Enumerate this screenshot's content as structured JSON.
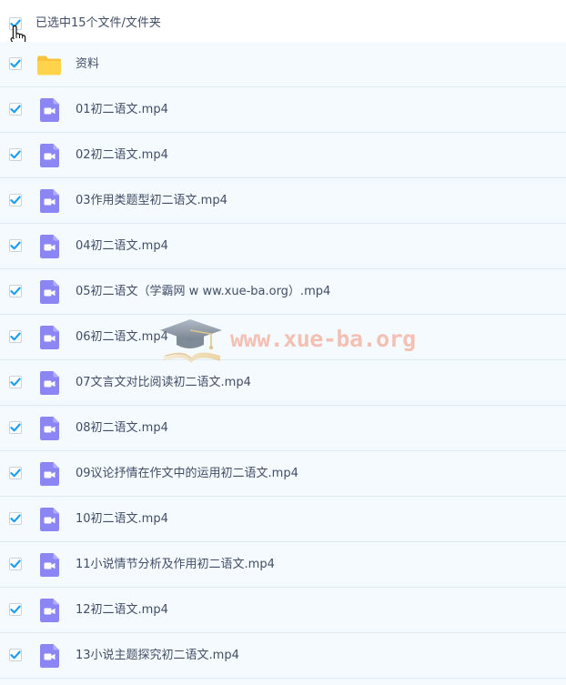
{
  "header": {
    "selection_label": "已选中15个文件/文件夹"
  },
  "colors": {
    "check": "#1e9ff2",
    "video_icon": "#8c86f5",
    "folder_icon": "#ffd44b",
    "row_bg": "#f5fafe",
    "divider": "#dfeaf3",
    "text": "#424e67"
  },
  "files": [
    {
      "name": "资料",
      "type": "folder",
      "icon": "folder-icon",
      "checked": true
    },
    {
      "name": "01初二语文.mp4",
      "type": "video",
      "icon": "video-file-icon",
      "checked": true
    },
    {
      "name": "02初二语文.mp4",
      "type": "video",
      "icon": "video-file-icon",
      "checked": true
    },
    {
      "name": "03作用类题型初二语文.mp4",
      "type": "video",
      "icon": "video-file-icon",
      "checked": true
    },
    {
      "name": "04初二语文.mp4",
      "type": "video",
      "icon": "video-file-icon",
      "checked": true
    },
    {
      "name": "05初二语文（学霸网 w ww.xue-ba.org）.mp4",
      "type": "video",
      "icon": "video-file-icon",
      "checked": true
    },
    {
      "name": "06初二语文.mp4",
      "type": "video",
      "icon": "video-file-icon",
      "checked": true
    },
    {
      "name": "07文言文对比阅读初二语文.mp4",
      "type": "video",
      "icon": "video-file-icon",
      "checked": true
    },
    {
      "name": "08初二语文.mp4",
      "type": "video",
      "icon": "video-file-icon",
      "checked": true
    },
    {
      "name": "09议论抒情在作文中的运用初二语文.mp4",
      "type": "video",
      "icon": "video-file-icon",
      "checked": true
    },
    {
      "name": "10初二语文.mp4",
      "type": "video",
      "icon": "video-file-icon",
      "checked": true
    },
    {
      "name": "11小说情节分析及作用初二语文.mp4",
      "type": "video",
      "icon": "video-file-icon",
      "checked": true
    },
    {
      "name": "12初二语文.mp4",
      "type": "video",
      "icon": "video-file-icon",
      "checked": true
    },
    {
      "name": "13小说主题探究初二语文.mp4",
      "type": "video",
      "icon": "video-file-icon",
      "checked": true
    }
  ],
  "watermark": {
    "text": "www.xue-ba.org",
    "icon": "graduation-cap-logo"
  }
}
